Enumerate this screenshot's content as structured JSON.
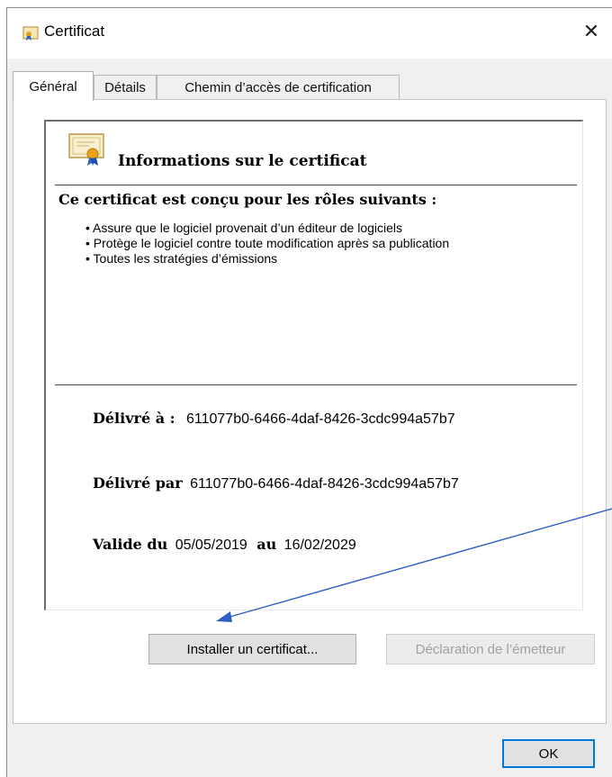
{
  "window": {
    "title": "Certificat",
    "close_symbol": "✕"
  },
  "tabs": [
    {
      "label": "Général"
    },
    {
      "label": "Détails"
    },
    {
      "label": "Chemin d’accès de certification"
    }
  ],
  "info": {
    "title": "Informations sur le certificat",
    "roles_title": "Ce certificat est conçu pour les rôles suivants :",
    "roles": [
      "• Assure que le logiciel provenait d’un éditeur de logiciels",
      "• Protège le logiciel contre toute modification après sa publication",
      "• Toutes les stratégies d’émissions"
    ]
  },
  "fields": {
    "issued_to_label": "Délivré à :",
    "issued_to_value": "611077b0-6466-4daf-8426-3cdc994a57b7",
    "issued_by_label": "Délivré par",
    "issued_by_value": "611077b0-6466-4daf-8426-3cdc994a57b7",
    "valid_label": "Valide du",
    "valid_from": "05/05/2019",
    "to_label": "au",
    "valid_to": "16/02/2029"
  },
  "buttons": {
    "install": "Installer un certificat...",
    "issuer_statement": "Déclaration de l’émetteur",
    "ok": "OK"
  },
  "colors": {
    "arrow": "#2f5fc4",
    "default_button_border": "#0078d7"
  },
  "icons": {
    "title_icon": "certificate-icon",
    "info_icon": "certificate-ribbon-icon",
    "close": "close-icon"
  }
}
